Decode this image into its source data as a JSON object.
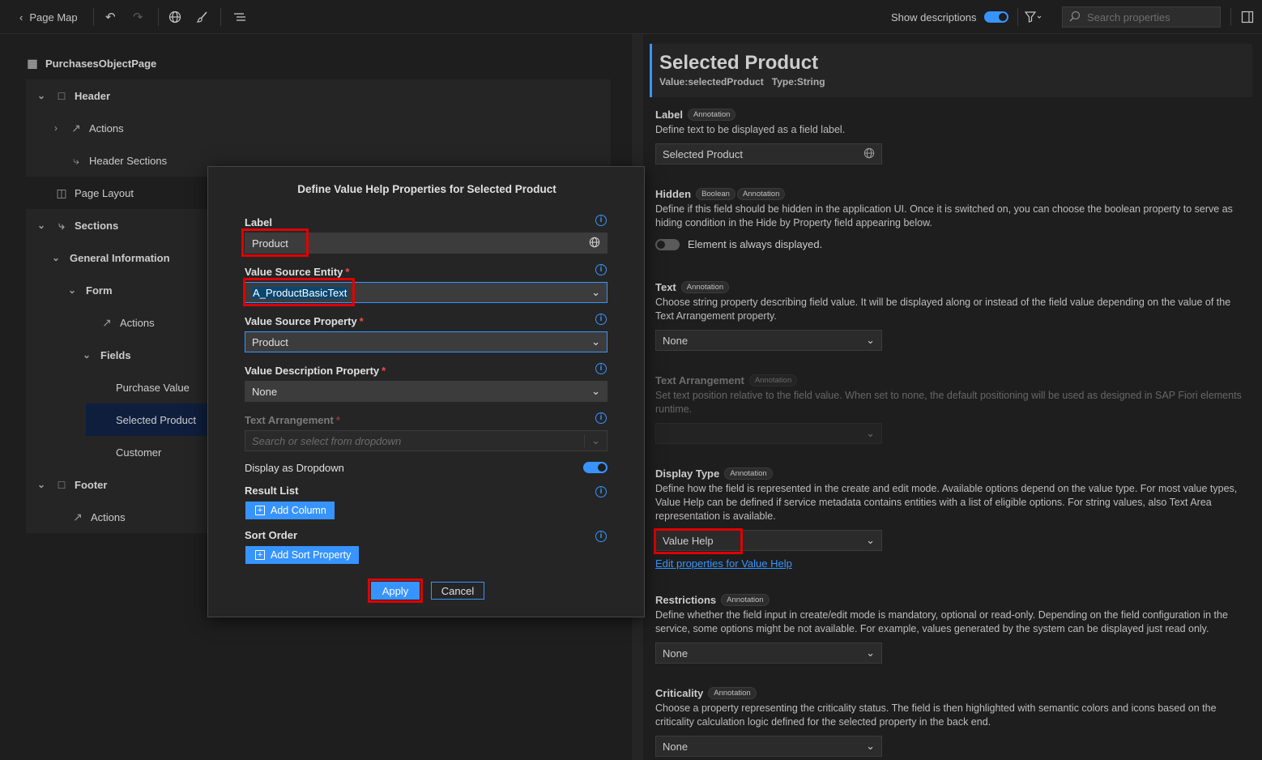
{
  "toolbar": {
    "back_label": "Page Map",
    "show_descriptions_label": "Show descriptions",
    "search_placeholder": "Search properties"
  },
  "tree": {
    "root": "PurchasesObjectPage",
    "header": "Header",
    "header_actions": "Actions",
    "header_sections": "Header Sections",
    "page_layout": "Page Layout",
    "sections": "Sections",
    "general_information": "General Information",
    "form": "Form",
    "form_actions": "Actions",
    "fields": "Fields",
    "field_purchase_value": "Purchase Value",
    "field_selected_product": "Selected Product",
    "field_customer": "Customer",
    "footer": "Footer",
    "footer_actions": "Actions"
  },
  "dialog": {
    "title": "Define Value Help Properties for Selected Product",
    "label_label": "Label",
    "label_value": "Product",
    "entity_label": "Value Source Entity",
    "entity_value": "A_ProductBasicText",
    "property_label": "Value Source Property",
    "property_value": "Product",
    "desc_property_label": "Value Description Property",
    "desc_property_value": "None",
    "text_arrangement_label": "Text Arrangement",
    "text_arrangement_placeholder": "Search or select from dropdown",
    "dropdown_label": "Display as Dropdown",
    "result_list_label": "Result List",
    "add_column": "Add Column",
    "sort_order_label": "Sort Order",
    "add_sort_property": "Add Sort Property",
    "apply": "Apply",
    "cancel": "Cancel",
    "required_mark": "*"
  },
  "properties": {
    "title": "Selected Product",
    "value_label": "Value:",
    "value": "selectedProduct",
    "type_label": "Type:",
    "type": "String",
    "label": {
      "title": "Label",
      "badge": "Annotation",
      "desc": "Define text to be displayed as a field label.",
      "value": "Selected Product"
    },
    "hidden": {
      "title": "Hidden",
      "badge1": "Boolean",
      "badge2": "Annotation",
      "desc": "Define if this field should be hidden in the application UI. Once it is switched on, you can choose the boolean property to serve as hiding condition in the Hide by Property field appearing below.",
      "toggle_text": "Element is always displayed."
    },
    "text": {
      "title": "Text",
      "badge": "Annotation",
      "desc": "Choose string property describing field value. It will be displayed along or instead of the field value depending on the value of the Text Arrangement property.",
      "value": "None"
    },
    "text_arrangement": {
      "title": "Text Arrangement",
      "badge": "Annotation",
      "desc": "Set text position relative to the field value. When set to none, the default positioning will be used as designed in SAP Fiori elements runtime.",
      "value": ""
    },
    "display_type": {
      "title": "Display Type",
      "badge": "Annotation",
      "desc": "Define how the field is represented in the create and edit mode. Available options depend on the value type. For most value types, Value Help can be defined if service metadata contains entities with a list of eligible options. For string values, also Text Area representation is available.",
      "value": "Value Help",
      "link": "Edit properties for Value Help"
    },
    "restrictions": {
      "title": "Restrictions",
      "badge": "Annotation",
      "desc": "Define whether the field input in create/edit mode is mandatory, optional or read-only. Depending on the field configuration in the service, some options might be not available. For example, values generated by the system can be displayed just read only.",
      "value": "None"
    },
    "criticality": {
      "title": "Criticality",
      "badge": "Annotation",
      "desc": "Choose a property representing the criticality status. The field is then highlighted with semantic colors and icons based on the criticality calculation logic defined for the selected property in the back end.",
      "value": "None"
    }
  },
  "colors": {
    "accent": "#3794ff",
    "highlight": "#e00000",
    "background": "#1e1e1e"
  },
  "toggles": {
    "show_descriptions": true,
    "display_as_dropdown": true,
    "hidden": false
  }
}
